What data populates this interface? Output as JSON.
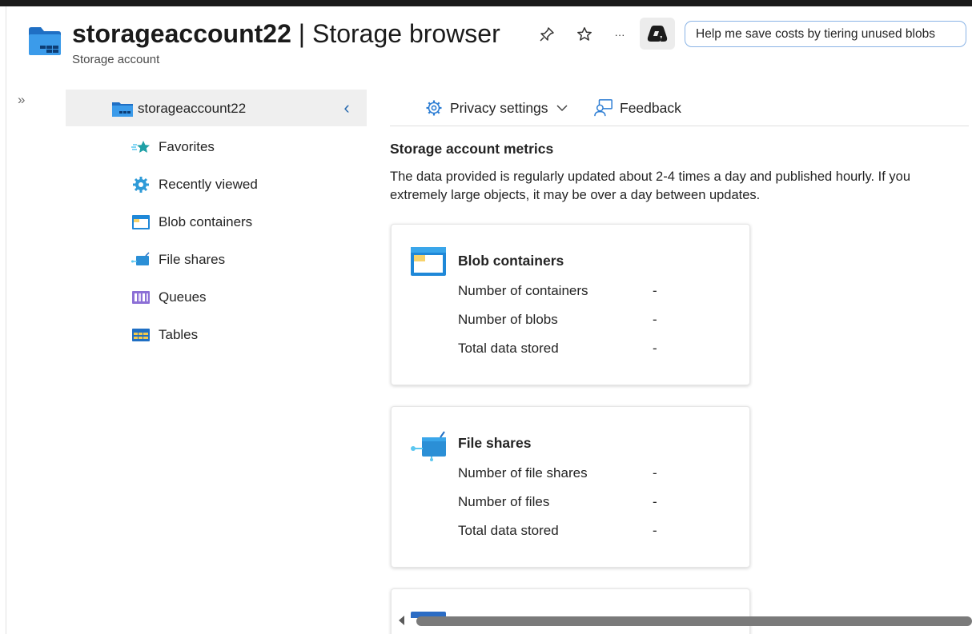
{
  "header": {
    "title_bold": "storageaccount22",
    "title_rest": " | Storage browser",
    "subtitle": "Storage account",
    "suggestion": "Help me save costs by tiering unused blobs",
    "more_label": "···"
  },
  "tree": {
    "root_label": "storageaccount22",
    "items": [
      {
        "label": "Favorites",
        "icon": "star-icon"
      },
      {
        "label": "Recently viewed",
        "icon": "gear-icon"
      },
      {
        "label": "Blob containers",
        "icon": "blob-container-icon"
      },
      {
        "label": "File shares",
        "icon": "file-share-icon"
      },
      {
        "label": "Queues",
        "icon": "queue-icon"
      },
      {
        "label": "Tables",
        "icon": "table-icon"
      }
    ]
  },
  "commands": {
    "privacy": "Privacy settings",
    "feedback": "Feedback"
  },
  "main": {
    "section_title": "Storage account metrics",
    "description_line1": "The data provided is regularly updated about 2-4 times a day and published hourly. If you",
    "description_line2": "extremely large objects, it may be over a day between updates."
  },
  "cards": [
    {
      "title": "Blob containers",
      "metrics": [
        {
          "label": "Number of containers",
          "value": "-"
        },
        {
          "label": "Number of blobs",
          "value": "-"
        },
        {
          "label": "Total data stored",
          "value": "-"
        }
      ]
    },
    {
      "title": "File shares",
      "metrics": [
        {
          "label": "Number of file shares",
          "value": "-"
        },
        {
          "label": "Number of files",
          "value": "-"
        },
        {
          "label": "Total data stored",
          "value": "-"
        }
      ]
    }
  ],
  "colors": {
    "accent": "#0078d4",
    "selected_bg": "#efefef",
    "pill_border": "#8ab4e6"
  }
}
